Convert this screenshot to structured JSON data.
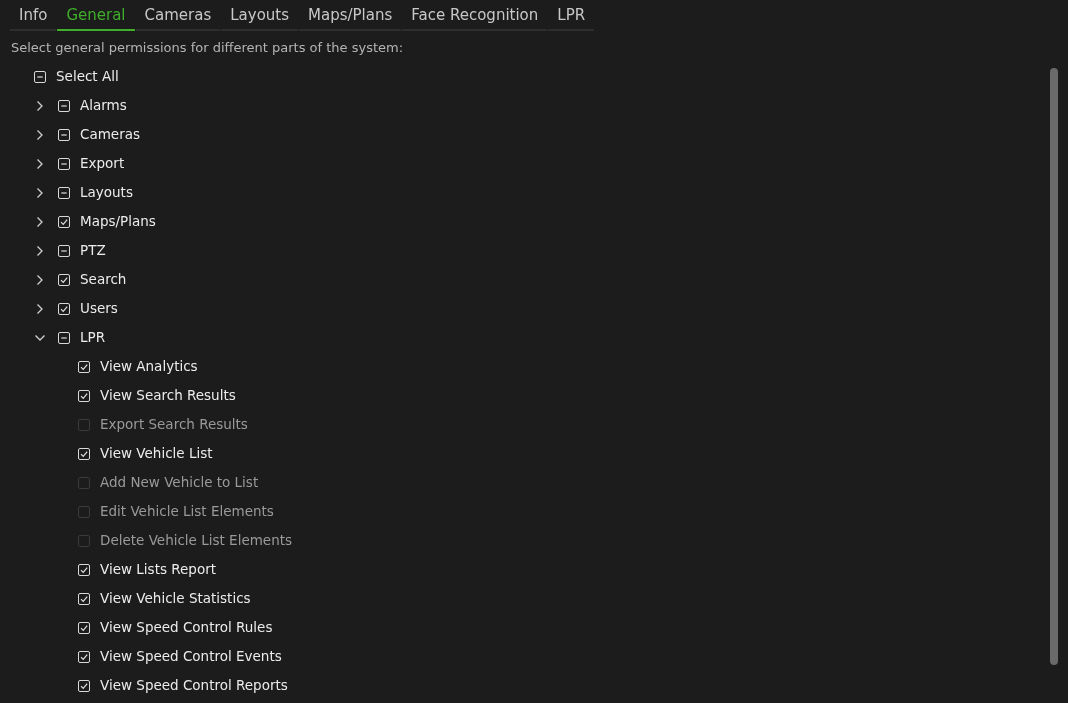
{
  "tabs": [
    {
      "label": "Info",
      "selected": false
    },
    {
      "label": "General",
      "selected": true
    },
    {
      "label": "Cameras",
      "selected": false
    },
    {
      "label": "Layouts",
      "selected": false
    },
    {
      "label": "Maps/Plans",
      "selected": false
    },
    {
      "label": "Face Recognition",
      "selected": false
    },
    {
      "label": "LPR",
      "selected": false
    }
  ],
  "description": "Select general permissions for different parts of the system:",
  "select_all": {
    "label": "Select All",
    "checked": false,
    "partial": true
  },
  "tree": [
    {
      "label": "Alarms",
      "expanded": false,
      "checked": false,
      "partial": true
    },
    {
      "label": "Cameras",
      "expanded": false,
      "checked": false,
      "partial": true
    },
    {
      "label": "Export",
      "expanded": false,
      "checked": false,
      "partial": true
    },
    {
      "label": "Layouts",
      "expanded": false,
      "checked": false,
      "partial": true
    },
    {
      "label": "Maps/Plans",
      "expanded": false,
      "checked": true,
      "partial": false
    },
    {
      "label": "PTZ",
      "expanded": false,
      "checked": false,
      "partial": true
    },
    {
      "label": "Search",
      "expanded": false,
      "checked": true,
      "partial": false
    },
    {
      "label": "Users",
      "expanded": false,
      "checked": true,
      "partial": false
    },
    {
      "label": "LPR",
      "expanded": true,
      "checked": false,
      "partial": true,
      "children": [
        {
          "label": "View Analytics",
          "checked": true
        },
        {
          "label": "View Search Results",
          "checked": true
        },
        {
          "label": "Export Search Results",
          "checked": false
        },
        {
          "label": "View Vehicle List",
          "checked": true
        },
        {
          "label": "Add New Vehicle to List",
          "checked": false
        },
        {
          "label": "Edit Vehicle List Elements",
          "checked": false
        },
        {
          "label": "Delete Vehicle List Elements",
          "checked": false
        },
        {
          "label": "View Lists Report",
          "checked": true
        },
        {
          "label": "View Vehicle Statistics",
          "checked": true
        },
        {
          "label": "View Speed Control Rules",
          "checked": true
        },
        {
          "label": "View Speed Control Events",
          "checked": true
        },
        {
          "label": "View Speed Control Reports",
          "checked": true
        }
      ]
    }
  ]
}
